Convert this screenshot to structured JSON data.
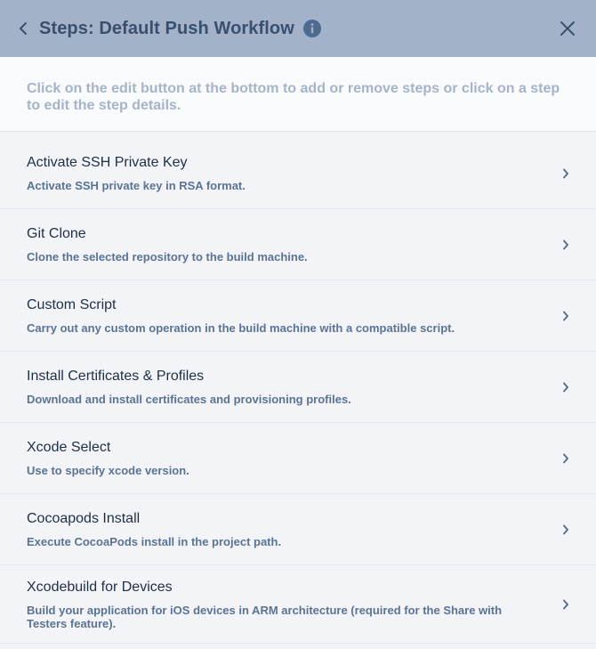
{
  "header": {
    "title": "Steps: Default Push Workflow"
  },
  "description": "Click on the edit button at the bottom to add or remove steps or click on a step to edit the step details.",
  "steps": [
    {
      "name": "Activate SSH Private Key",
      "description": "Activate SSH private key in RSA format."
    },
    {
      "name": "Git Clone",
      "description": "Clone the selected repository to the build machine."
    },
    {
      "name": "Custom Script",
      "description": "Carry out any custom operation in the build machine with a compatible script."
    },
    {
      "name": "Install Certificates & Profiles",
      "description": "Download and install certificates and provisioning profiles."
    },
    {
      "name": "Xcode Select",
      "description": "Use to specify xcode version."
    },
    {
      "name": "Cocoapods Install",
      "description": "Execute CocoaPods install in the project path."
    },
    {
      "name": "Xcodebuild for Devices",
      "description": "Build your application for iOS devices in ARM architecture (required for the Share with Testers feature)."
    }
  ],
  "icons": {
    "back": "chevron-left-icon",
    "info": "info-icon",
    "close": "close-icon",
    "step_chevron": "chevron-right-icon"
  },
  "colors": {
    "header_bg": "#a3b2c8",
    "title": "#38506e",
    "info_badge": "#4d6a8f",
    "description_text": "#a5b4c8",
    "step_subtitle": "#5a7394",
    "background": "#f3f4f7"
  }
}
